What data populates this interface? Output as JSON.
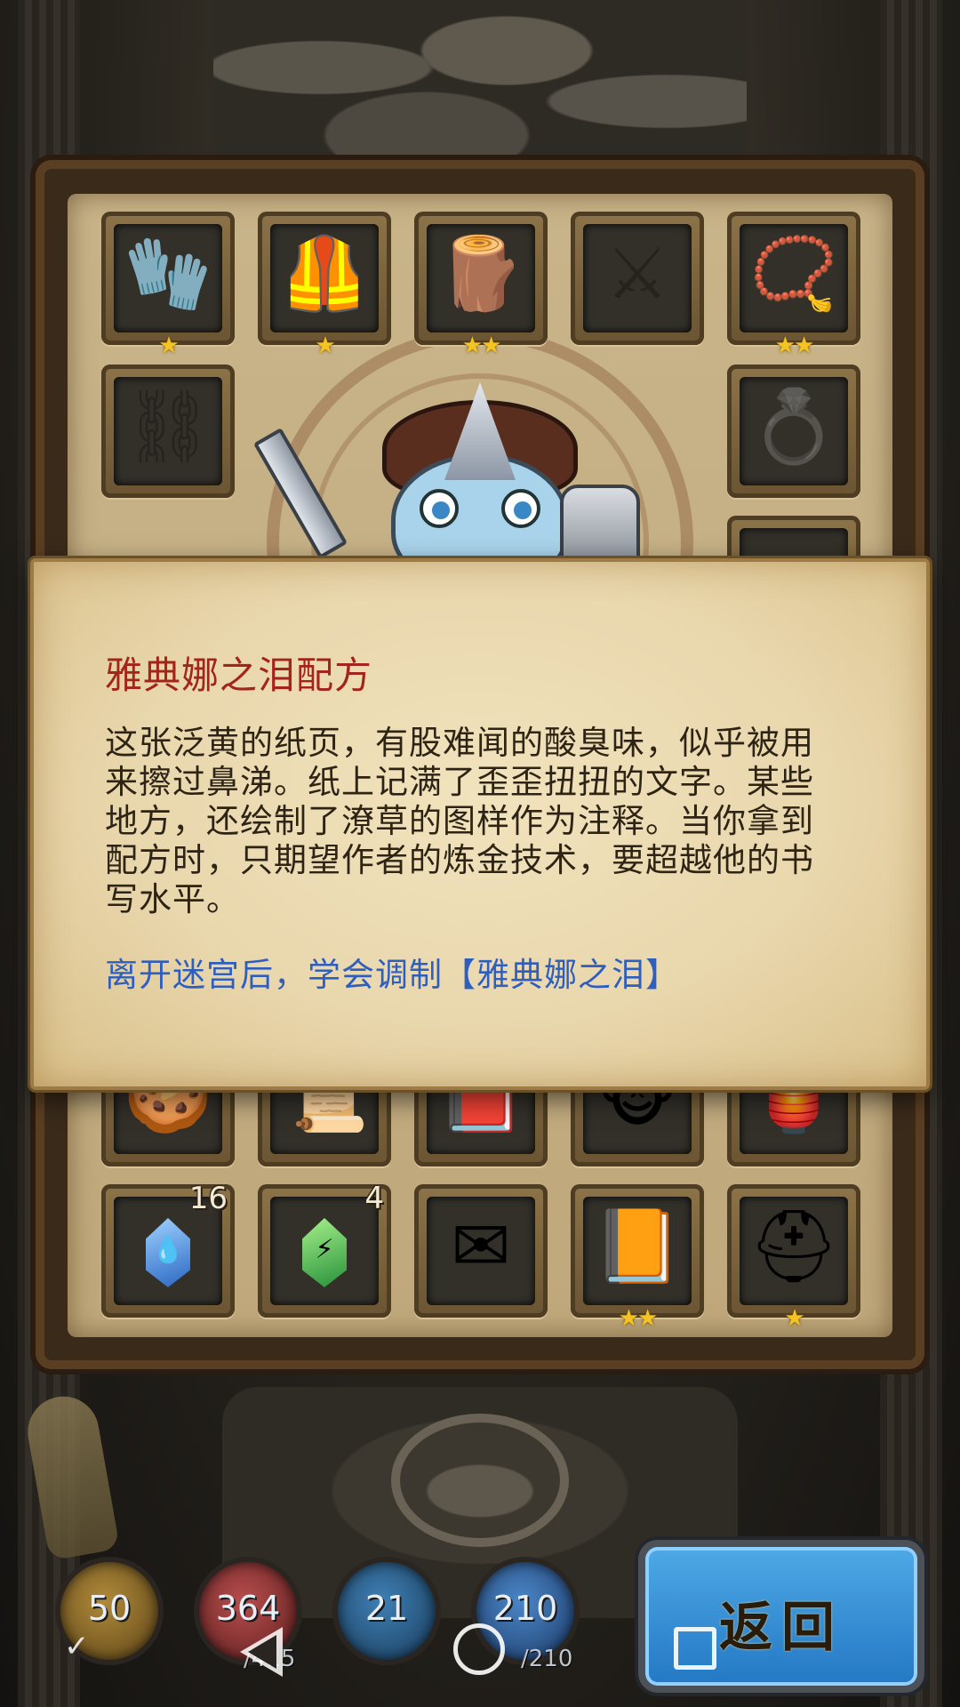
{
  "inventory": {
    "equipment_slots": [
      {
        "item": "gauntlet-icon",
        "glyph": "🧤",
        "stars": "★",
        "empty": false
      },
      {
        "item": "chest-armor-icon",
        "glyph": "🦺",
        "stars": "★",
        "empty": false
      },
      {
        "item": "wooden-staff-icon",
        "glyph": "🪵",
        "stars": "★★",
        "empty": false
      },
      {
        "item": "crossbow-placeholder-icon",
        "glyph": "⚔",
        "stars": "",
        "empty": true
      },
      {
        "item": "sapphire-necklace-icon",
        "glyph": "📿",
        "stars": "★★",
        "empty": false
      },
      {
        "item": "belt-placeholder-icon",
        "glyph": "⛓",
        "stars": "",
        "empty": true
      },
      {
        "item": "ring-placeholder-icon",
        "glyph": "💍",
        "stars": "",
        "empty": true
      }
    ],
    "bag_row_1": [
      {
        "item": "cookie-icon",
        "glyph": "🍪"
      },
      {
        "item": "scroll-icon",
        "glyph": "📜"
      },
      {
        "item": "spellbook-icon",
        "glyph": "📕"
      },
      {
        "item": "monkey-mask-icon",
        "glyph": "🐵"
      },
      {
        "item": "fire-lantern-icon",
        "glyph": "🏮"
      }
    ],
    "bag_row_2": [
      {
        "item": "blue-crystal-icon",
        "count": "16",
        "mark": "💧"
      },
      {
        "item": "green-crystal-icon",
        "count": "4",
        "mark": "⚡"
      },
      {
        "item": "sealed-letter-icon",
        "glyph": "✉",
        "stars": ""
      },
      {
        "item": "golden-tome-icon",
        "glyph": "📙",
        "stars": "★★"
      },
      {
        "item": "horned-helmet-icon",
        "glyph": "⛑",
        "stars": "★"
      }
    ]
  },
  "popup": {
    "title": "雅典娜之泪配方",
    "description": "这张泛黄的纸页，有股难闻的酸臭味，似乎被用来擦过鼻涕。纸上记满了歪歪扭扭的文字。某些地方，还绘制了潦草的图样作为注释。当你拿到配方时，只期望作者的炼金技术，要超越他的书写水平。",
    "effect": "离开迷宫后，学会调制【雅典娜之泪】"
  },
  "stats": {
    "gold": "50",
    "hp": "364",
    "hp_max": "/415",
    "attack": "21",
    "mp": "210",
    "mp_max": "/210"
  },
  "return_button": "返回",
  "colors": {
    "title_red": "#a3241a",
    "effect_blue": "#2e5fbf",
    "star_gold": "#f5c422",
    "button_blue": "#2478c4"
  }
}
